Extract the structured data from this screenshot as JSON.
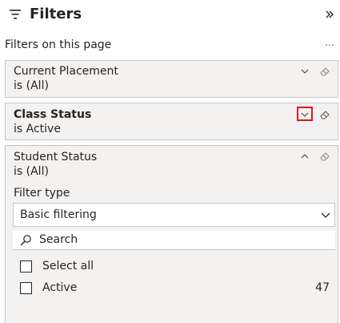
{
  "pane": {
    "title": "Filters",
    "section_label": "Filters on this page",
    "more_glyph": "..."
  },
  "cards": [
    {
      "name": "Current Placement",
      "summary": "is (All)",
      "expanded": false,
      "highlighted": false
    },
    {
      "name": "Class Status",
      "summary": "is Active",
      "expanded": false,
      "highlighted": true
    },
    {
      "name": "Student Status",
      "summary": "is (All)",
      "expanded": true,
      "highlighted": false
    }
  ],
  "student_status": {
    "filter_type_label": "Filter type",
    "filter_type_value": "Basic filtering",
    "search_placeholder": "Search",
    "items": [
      {
        "label": "Select all",
        "count": "",
        "checked": false
      },
      {
        "label": "Active",
        "count": "47",
        "checked": false
      }
    ]
  },
  "colors": {
    "card_bg": "#f3f2f1",
    "card_border": "#c8c6c4",
    "highlight": "#e81123",
    "text": "#252423"
  }
}
